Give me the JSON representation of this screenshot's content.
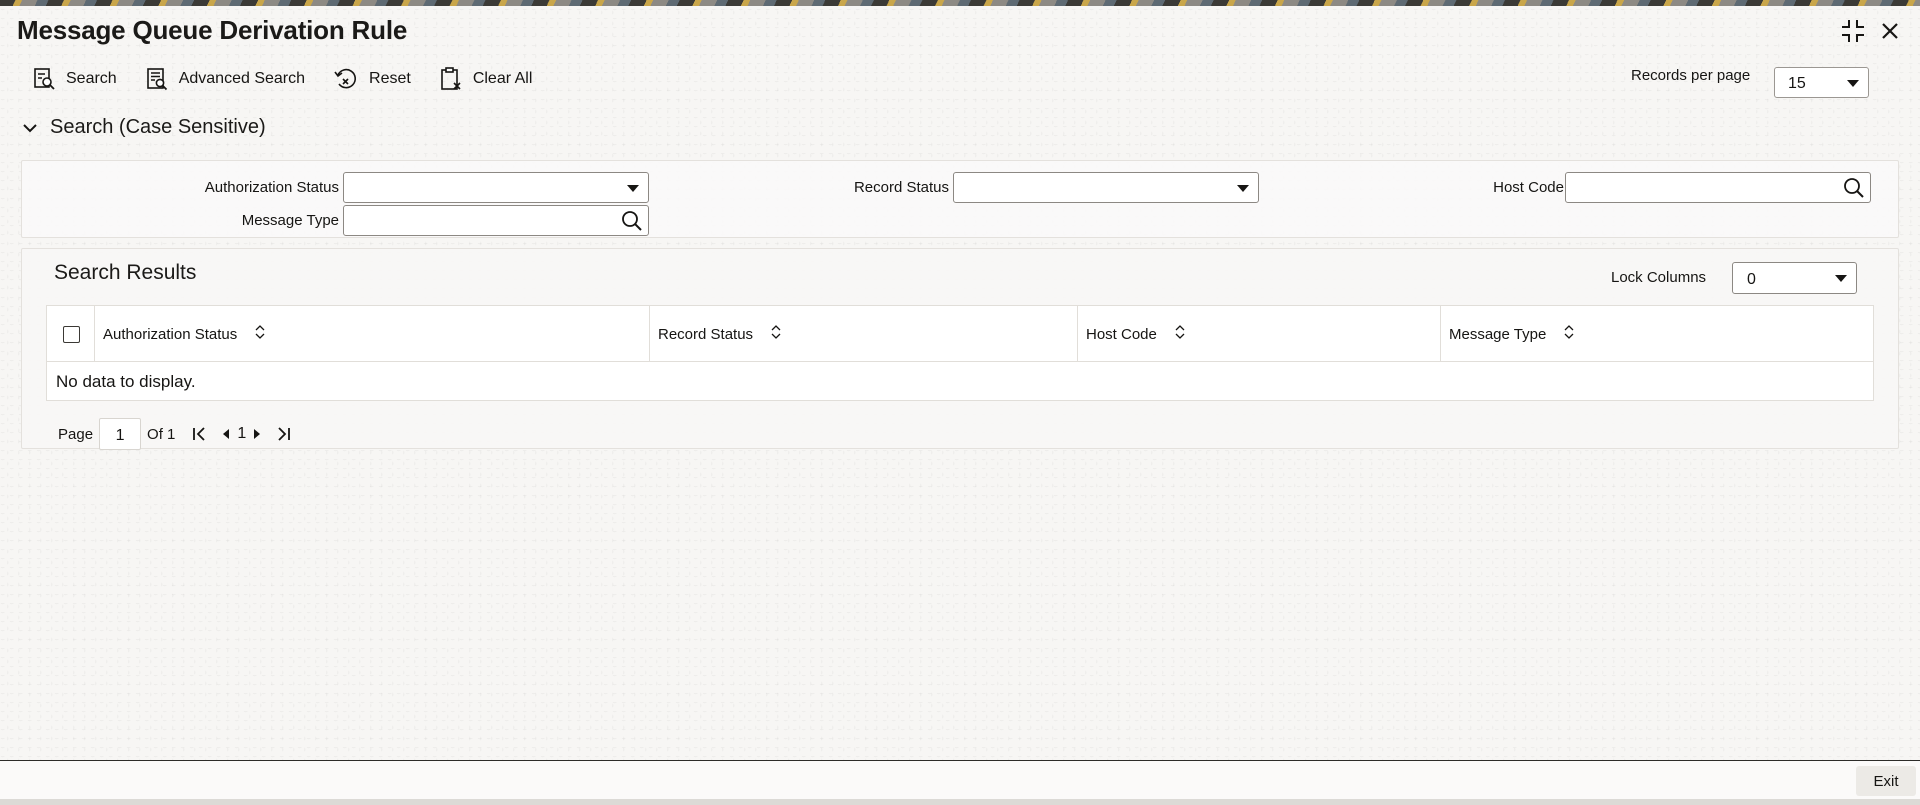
{
  "window": {
    "title": "Message Queue Derivation Rule",
    "icons": [
      "collapse-icon",
      "close-icon"
    ]
  },
  "toolbar": {
    "search_label": "Search",
    "advanced_search_label": "Advanced Search",
    "reset_label": "Reset",
    "clear_all_label": "Clear All"
  },
  "records_per_page": {
    "label": "Records per page",
    "value": "15"
  },
  "search_section": {
    "heading": "Search (Case Sensitive)",
    "fields": {
      "authorization_status": {
        "label": "Authorization Status",
        "value": ""
      },
      "record_status": {
        "label": "Record Status",
        "value": ""
      },
      "host_code": {
        "label": "Host Code",
        "value": ""
      },
      "message_type": {
        "label": "Message Type",
        "value": ""
      }
    }
  },
  "results": {
    "heading": "Search Results",
    "lock_columns": {
      "label": "Lock Columns",
      "value": "0"
    },
    "columns": [
      "Authorization Status",
      "Record Status",
      "Host Code",
      "Message Type"
    ],
    "rows": [],
    "empty_message": "No data to display."
  },
  "pager": {
    "page_label": "Page",
    "current_page": "1",
    "of_label": "Of 1",
    "page_link": "1"
  },
  "footer": {
    "exit_label": "Exit"
  },
  "colors": {
    "background": "#f7f6f4",
    "text": "#161513",
    "border": "#8c8883"
  }
}
